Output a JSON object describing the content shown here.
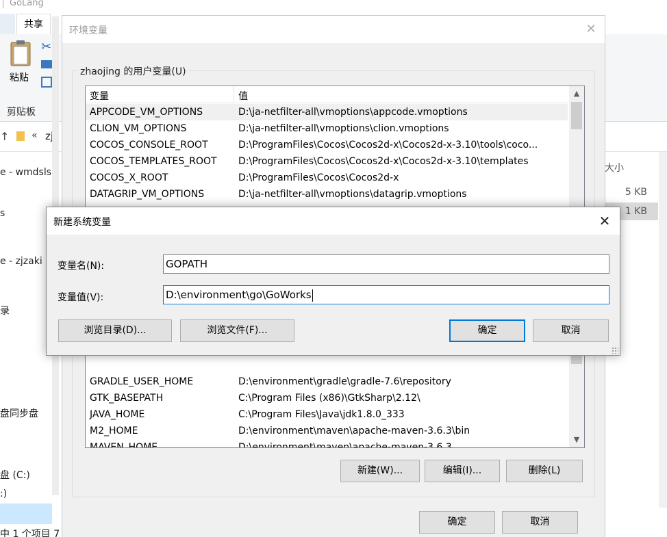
{
  "explorer": {
    "title": "GoLang",
    "tab_share": "共享",
    "paste_label": "粘贴",
    "clipboard_label": "剪贴板",
    "address_chevron": "«",
    "address_text": "zj",
    "sidebar_items": [
      "e - wmdsls",
      "s",
      "e - zjzaki",
      "录",
      "盘同步盘",
      "盘 (C:)",
      ":)"
    ],
    "size_header": "大小",
    "sizes": [
      "5 KB",
      "1 KB"
    ],
    "status": "中 1 个项目 7"
  },
  "env_dialog": {
    "title": "环境变量",
    "user_group_label": "zhaojing 的用户变量(U)",
    "col_name": "变量",
    "col_value": "值",
    "rows_top": [
      {
        "name": "APPCODE_VM_OPTIONS",
        "value": "D:\\ja-netfilter-all\\vmoptions\\appcode.vmoptions"
      },
      {
        "name": "CLION_VM_OPTIONS",
        "value": "D:\\ja-netfilter-all\\vmoptions\\clion.vmoptions"
      },
      {
        "name": "COCOS_CONSOLE_ROOT",
        "value": "D:\\ProgramFiles\\Cocos\\Cocos2d-x\\Cocos2d-x-3.10\\tools\\coco..."
      },
      {
        "name": "COCOS_TEMPLATES_ROOT",
        "value": "D:\\ProgramFiles\\Cocos\\Cocos2d-x\\Cocos2d-x-3.10\\templates"
      },
      {
        "name": "COCOS_X_ROOT",
        "value": "D:\\ProgramFiles\\Cocos\\Cocos2d-x"
      },
      {
        "name": "DATAGRIP_VM_OPTIONS",
        "value": "D:\\ja-netfilter-all\\vmoptions\\datagrip.vmoptions"
      }
    ],
    "rows_bottom": [
      {
        "name": "GRADLE_USER_HOME",
        "value": "D:\\environment\\gradle\\gradle-7.6\\repository"
      },
      {
        "name": "GTK_BASEPATH",
        "value": "C:\\Program Files (x86)\\GtkSharp\\2.12\\"
      },
      {
        "name": "JAVA_HOME",
        "value": "C:\\Program Files\\Java\\jdk1.8.0_333"
      },
      {
        "name": "M2_HOME",
        "value": "D:\\environment\\maven\\apache-maven-3.6.3\\bin"
      },
      {
        "name": "MAVEN_HOME",
        "value": "D:\\environment\\maven\\apache-maven-3.6.3"
      }
    ],
    "btn_new": "新建(W)...",
    "btn_edit": "编辑(I)...",
    "btn_delete": "删除(L)",
    "btn_ok": "确定",
    "btn_cancel": "取消"
  },
  "new_dialog": {
    "title": "新建系统变量",
    "name_label": "变量名(N):",
    "name_value": "GOPATH",
    "value_label": "变量值(V):",
    "value_value": "D:\\environment\\go\\GoWorks",
    "btn_browse_dir": "浏览目录(D)...",
    "btn_browse_file": "浏览文件(F)...",
    "btn_ok": "确定",
    "btn_cancel": "取消"
  }
}
